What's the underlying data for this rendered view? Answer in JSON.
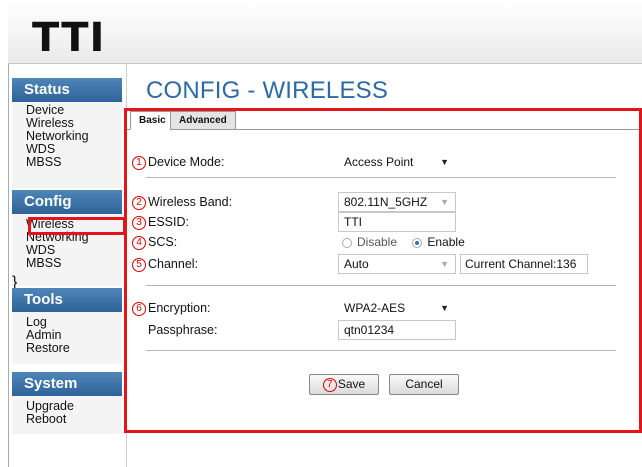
{
  "brand": {
    "logo_text": "TTI"
  },
  "page_title": "CONFIG - WIRELESS",
  "sidebar": {
    "status": {
      "title": "Status",
      "items": [
        "Device",
        "Wireless",
        "Networking",
        "WDS",
        "MBSS"
      ]
    },
    "config": {
      "title": "Config",
      "items": [
        "Wireless",
        "Networking",
        "WDS",
        "MBSS"
      ]
    },
    "tools": {
      "title": "Tools",
      "items": [
        "Log",
        "Admin",
        "Restore"
      ]
    },
    "system": {
      "title": "System",
      "items": [
        "Upgrade",
        "Reboot"
      ]
    }
  },
  "tabs": {
    "basic": "Basic",
    "advanced": "Advanced"
  },
  "form": {
    "device_mode": {
      "number": "1",
      "label": "Device Mode:",
      "value": "Access Point"
    },
    "wireless_band": {
      "number": "2",
      "label": "Wireless Band:",
      "value": "802.11N_5GHZ"
    },
    "essid": {
      "number": "3",
      "label": "ESSID:",
      "value": "TTI"
    },
    "scs": {
      "number": "4",
      "label": "SCS:",
      "option_disable": "Disable",
      "option_enable": "Enable",
      "selected": "Enable"
    },
    "channel": {
      "number": "5",
      "label": "Channel:",
      "value": "Auto",
      "current_channel": "Current Channel:136"
    },
    "encryption": {
      "number": "6",
      "label": "Encryption:",
      "value": "WPA2-AES"
    },
    "passphrase": {
      "label": "Passphrase:",
      "value": "qtn01234"
    }
  },
  "buttons": {
    "save_number": "7",
    "save": "Save",
    "cancel": "Cancel"
  },
  "colors": {
    "accent": "#2d6aa3",
    "sidebar_header": "#3b73a8",
    "highlight": "#e3151a"
  }
}
